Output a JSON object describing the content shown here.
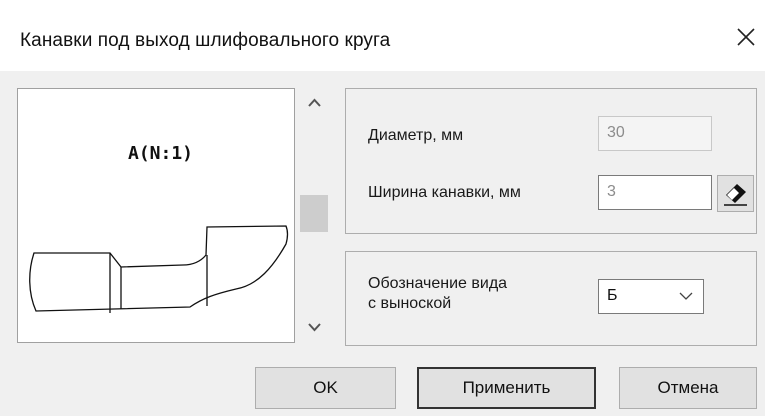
{
  "dialog": {
    "title": "Канавки под выход шлифовального круга",
    "close_icon": "close-icon"
  },
  "preview": {
    "label": "A(N:1)"
  },
  "scrollbar": {
    "up_icon": "chevron-up-icon",
    "down_icon": "chevron-down-icon"
  },
  "dimensions": {
    "diameter_label": "Диаметр, мм",
    "diameter_value": "30",
    "width_label": "Ширина канавки, мм",
    "width_value": "3",
    "eraser_icon": "eraser-icon"
  },
  "view": {
    "label_line1": "Обозначение вида",
    "label_line2": "с выноской",
    "selected": "Б"
  },
  "buttons": {
    "ok": "OK",
    "apply": "Применить",
    "cancel": "Отмена"
  }
}
